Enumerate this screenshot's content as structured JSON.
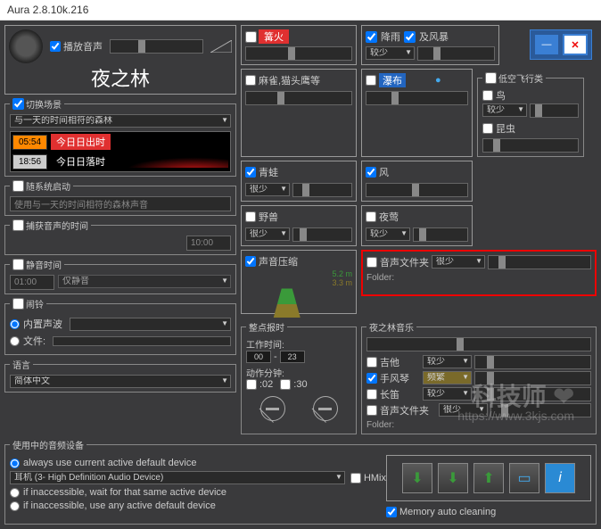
{
  "window": {
    "title": "Aura 2.8.10k.216"
  },
  "left": {
    "play_label": "播放音声",
    "big_title": "夜之林",
    "scene_switch": "切换场景",
    "scene_select": "与一天的时间相符的森林",
    "sunrise_time": "05:54",
    "sunrise_label": "今日日出时",
    "sunset_time": "18:56",
    "sunset_label": "今日日落时",
    "autostart": "随系统启动",
    "autostart_value": "使用与一天的时间相符的森林声音",
    "fade_time_label": "捕获音声的时间",
    "fade_time_value": "10:00",
    "mute_label": "静音时间",
    "mute_time": "01:00",
    "mute_opt": "仅静音",
    "alarm_label": "闹铃",
    "alarm_builtin": "内置声波",
    "alarm_file": "文件:",
    "lang_label": "语言",
    "lang_value": "简体中文"
  },
  "sounds": {
    "fire": "篝火",
    "rain": "降雨",
    "wind": "及风暴",
    "crow": "麻雀,猫头鹰等",
    "waterfall": "瀑布",
    "lowfly": "低空飞行类",
    "frog": "青蛙",
    "wind2": "风",
    "bird": "鸟",
    "beast": "野兽",
    "nightingale": "夜莺",
    "insect": "昆虫",
    "compress": "声音压缩",
    "compress_h": "5.2 m",
    "compress_l": "3.3 m",
    "sound_folder": "音声文件夹",
    "folder_label": "Folder:"
  },
  "freq": {
    "rare": "很少",
    "less": "较少",
    "frequent": "频繁"
  },
  "report": {
    "title": "整点报时",
    "work": "工作时间:",
    "work_from": "00",
    "work_to": "23",
    "interval": "动作分钟:",
    "i02": ":02",
    "i30": ":30"
  },
  "music": {
    "title": "夜之林音乐",
    "guitar": "吉他",
    "accordion": "手风琴",
    "flute": "长笛",
    "folder": "音声文件夹",
    "folder_label": "Folder:"
  },
  "audio": {
    "title": "使用中的音频设备",
    "opt_always": "always use current active default device",
    "device": "耳机 (3- High Definition Audio Device)",
    "hmix": "HMix",
    "opt_wait": "if inaccessible, wait for that same active device",
    "opt_any": "if inaccessible, use any active default device",
    "mem_clean": "Memory auto cleaning"
  },
  "watermark": {
    "text": "科技师",
    "url": "https://www.3kjs.com"
  }
}
